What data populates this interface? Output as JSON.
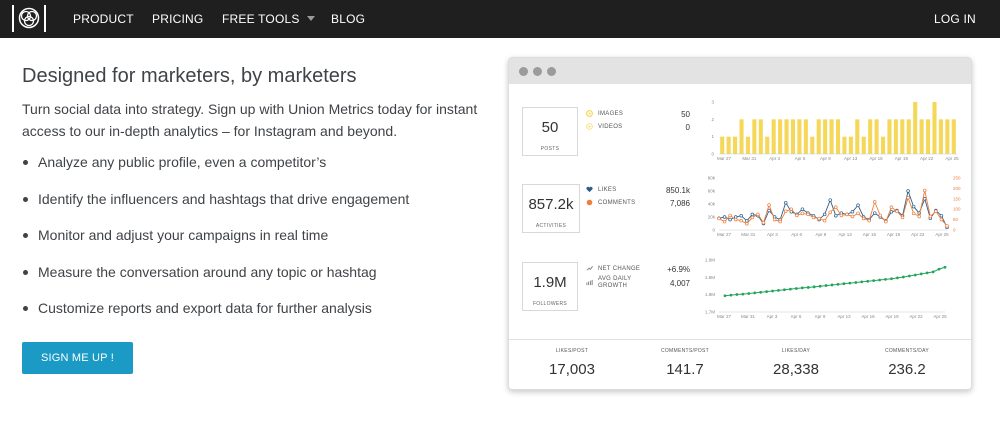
{
  "nav": {
    "items": [
      "PRODUCT",
      "PRICING",
      "FREE TOOLS",
      "BLOG"
    ],
    "login": "LOG IN"
  },
  "hero": {
    "headline": "Designed for marketers, by marketers",
    "intro": "Turn social data into strategy. Sign up with Union Metrics today for instant access to our in-depth analytics – for Instagram and beyond.",
    "bullets": [
      "Analyze any public profile, even a competitor’s",
      "Identify the influencers and hashtags that drive engagement",
      "Monitor and adjust your campaigns in real time",
      "Measure the conversation around any topic or hashtag",
      "Customize reports and export data for further analysis"
    ],
    "cta": "SIGN ME UP !"
  },
  "dashboard": {
    "posts": {
      "value": "50",
      "label": "POSTS",
      "legend": [
        {
          "label": "IMAGES",
          "value": "50"
        },
        {
          "label": "VIDEOS",
          "value": "0"
        }
      ]
    },
    "activities": {
      "value": "857.2k",
      "label": "ACTIVITIES",
      "legend": [
        {
          "label": "LIKES",
          "value": "850.1k"
        },
        {
          "label": "COMMENTS",
          "value": "7,086"
        }
      ]
    },
    "followers": {
      "value": "1.9M",
      "label": "FOLLOWERS",
      "legend": [
        {
          "label": "NET CHANGE",
          "value": "+6.9%"
        },
        {
          "label": "AVG DAILY",
          "label2": "GROWTH",
          "value": "4,007"
        }
      ]
    },
    "summary": [
      {
        "label": "LIKES/POST",
        "value": "17,003"
      },
      {
        "label": "COMMENTS/POST",
        "value": "141.7"
      },
      {
        "label": "LIKES/DAY",
        "value": "28,338"
      },
      {
        "label": "COMMENTS/DAY",
        "value": "236.2"
      }
    ],
    "colors": {
      "yellow": "#f5d85a",
      "blue": "#2c5f88",
      "orange": "#ef7d3c",
      "green": "#22a55b"
    }
  },
  "chart_data": [
    {
      "type": "bar",
      "x_ticks": [
        "Mar 27",
        "Mar 31",
        "Apr 3",
        "Apr 6",
        "Apr 9",
        "Apr 13",
        "Apr 16",
        "Apr 19",
        "Apr 22",
        "Apr 25"
      ],
      "y_ticks": [
        "0",
        "1",
        "2",
        "3"
      ],
      "ylim": [
        0,
        3
      ],
      "series": [
        {
          "values": [
            1,
            1,
            1,
            2,
            1,
            2,
            2,
            1,
            2,
            2,
            2,
            2,
            2,
            2,
            1,
            2,
            2,
            2,
            2,
            1,
            1,
            2,
            1,
            2,
            2,
            1,
            2,
            2,
            2,
            2,
            3,
            2,
            2,
            3,
            2,
            2,
            2
          ]
        }
      ]
    },
    {
      "type": "line",
      "x_ticks": [
        "Mar 27",
        "Mar 31",
        "Apr 3",
        "Apr 6",
        "Apr 9",
        "Apr 13",
        "Apr 16",
        "Apr 19",
        "Apr 22",
        "Apr 25"
      ],
      "y_ticks_left": [
        "0",
        "20k",
        "40k",
        "60k",
        "80k"
      ],
      "y_ticks_right": [
        "0",
        "50",
        "100",
        "150",
        "200",
        "250"
      ],
      "series": [
        {
          "name": "LIKES",
          "axis": "left",
          "values": [
            18,
            20,
            16,
            20,
            22,
            14,
            24,
            22,
            10,
            30,
            20,
            16,
            42,
            28,
            24,
            32,
            26,
            22,
            16,
            24,
            46,
            22,
            26,
            24,
            28,
            38,
            20,
            16,
            26,
            20,
            14,
            28,
            30,
            22,
            60,
            36,
            26,
            48,
            18,
            30,
            22,
            4
          ]
        },
        {
          "name": "COMMENTS",
          "axis": "right",
          "values": [
            55,
            40,
            70,
            50,
            45,
            30,
            60,
            75,
            35,
            120,
            50,
            40,
            90,
            100,
            70,
            80,
            75,
            60,
            55,
            45,
            85,
            110,
            70,
            75,
            65,
            80,
            55,
            45,
            135,
            70,
            40,
            110,
            90,
            60,
            155,
            80,
            65,
            190,
            65,
            90,
            50,
            20
          ]
        }
      ]
    },
    {
      "type": "line",
      "x_ticks": [
        "Mar 27",
        "Mar 31",
        "Apr 3",
        "Apr 6",
        "Apr 9",
        "Apr 13",
        "Apr 16",
        "Apr 19",
        "Apr 22",
        "Apr 25"
      ],
      "y_ticks": [
        "1.7M",
        "1.8M",
        "1.9M",
        "1.9M"
      ],
      "series": [
        {
          "name": "FOLLOWERS",
          "values": [
            1.778,
            1.781,
            1.784,
            1.786,
            1.789,
            1.792,
            1.795,
            1.798,
            1.801,
            1.804,
            1.807,
            1.81,
            1.813,
            1.816,
            1.818,
            1.821,
            1.824,
            1.827,
            1.83,
            1.833,
            1.836,
            1.839,
            1.842,
            1.845,
            1.848,
            1.851,
            1.854,
            1.857,
            1.86,
            1.864,
            1.868,
            1.873,
            1.878,
            1.883,
            1.888,
            1.893,
            1.906,
            1.915
          ]
        }
      ]
    }
  ]
}
